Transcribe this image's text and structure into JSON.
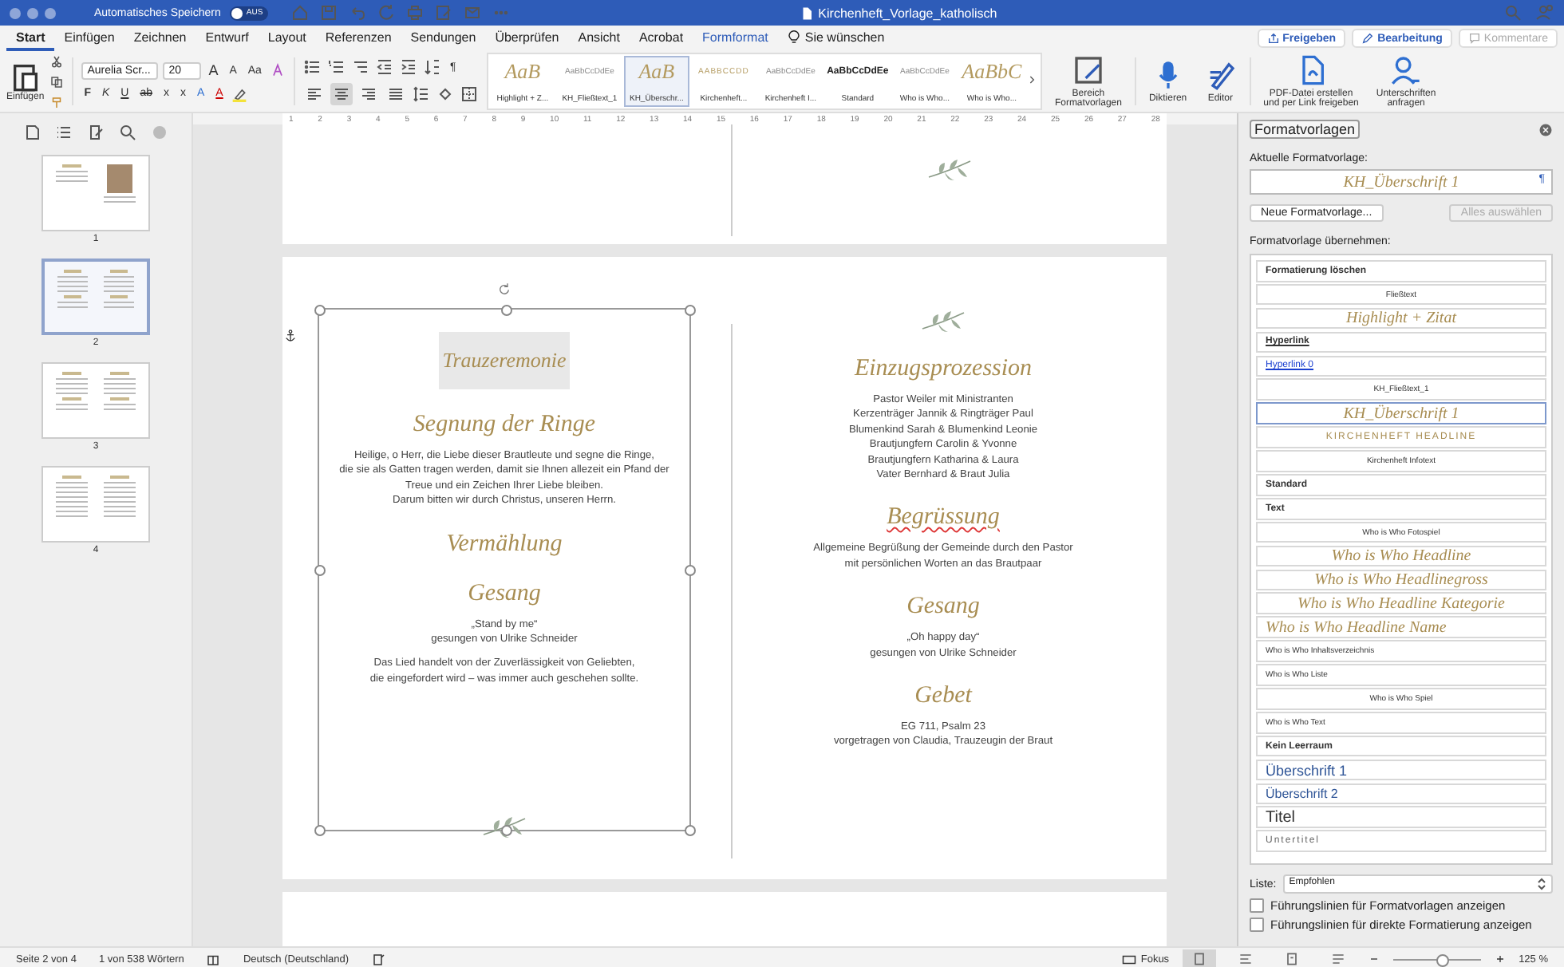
{
  "titlebar": {
    "autosave_label": "Automatisches Speichern",
    "autosave_on": false,
    "toggle_label": "AUS",
    "title": "Kirchenheft_Vorlage_katholisch"
  },
  "tabs": [
    {
      "label": "Start",
      "selected": true,
      "kind": "tab"
    },
    {
      "label": "Einfügen",
      "selected": false,
      "kind": "tab"
    },
    {
      "label": "Zeichnen",
      "selected": false,
      "kind": "tab"
    },
    {
      "label": "Entwurf",
      "selected": false,
      "kind": "tab"
    },
    {
      "label": "Layout",
      "selected": false,
      "kind": "tab"
    },
    {
      "label": "Referenzen",
      "selected": false,
      "kind": "tab"
    },
    {
      "label": "Sendungen",
      "selected": false,
      "kind": "tab"
    },
    {
      "label": "Überprüfen",
      "selected": false,
      "kind": "tab"
    },
    {
      "label": "Ansicht",
      "selected": false,
      "kind": "tab"
    },
    {
      "label": "Acrobat",
      "selected": false,
      "kind": "tab"
    },
    {
      "label": "Formformat",
      "selected": false,
      "kind": "contextual"
    },
    {
      "label": "Sie wünschen",
      "selected": false,
      "kind": "tell"
    }
  ],
  "tab_actions": [
    {
      "label": "Freigeben",
      "kind": "share",
      "disabled": false
    },
    {
      "label": "Bearbeitung",
      "kind": "edit",
      "disabled": false
    },
    {
      "label": "Kommentare",
      "kind": "comment",
      "disabled": true
    }
  ],
  "ribbon": {
    "paste_label": "Einfügen",
    "font_name": "Aurelia Scr...",
    "font_size": "20",
    "font_buttons": [
      {
        "label": "A",
        "kind": "grow"
      },
      {
        "label": "A",
        "kind": "shrink"
      },
      {
        "label": "Aa",
        "kind": "case"
      }
    ],
    "format_buttons": [
      {
        "label": "F",
        "kind": "bold"
      },
      {
        "label": "K",
        "kind": "italic"
      },
      {
        "label": "U",
        "kind": "underline"
      },
      {
        "label": "ab",
        "kind": "strike"
      },
      {
        "label": "x",
        "kind": "sub"
      },
      {
        "label": "x",
        "kind": "sup"
      },
      {
        "label": "A",
        "kind": "effect"
      },
      {
        "label": "A",
        "kind": "color"
      }
    ],
    "alignment": [
      {
        "selected": false
      },
      {
        "selected": true
      },
      {
        "selected": false
      },
      {
        "selected": false
      }
    ],
    "pilcrow": "¶",
    "styles": [
      {
        "preview": "AaB",
        "label": "Highlight + Z...",
        "kind": "script",
        "selected": false
      },
      {
        "preview": "AaBbCcDdEe",
        "label": "KH_Fließtext_1",
        "kind": "small",
        "selected": false
      },
      {
        "preview": "AaB",
        "label": "KH_Überschr...",
        "kind": "script",
        "selected": true
      },
      {
        "preview": "AABBCCDD",
        "label": "Kirchenheft...",
        "kind": "caps",
        "selected": false
      },
      {
        "preview": "AaBbCcDdEe",
        "label": "Kirchenheft I...",
        "kind": "small",
        "selected": false
      },
      {
        "preview": "AaBbCcDdEe",
        "label": "Standard",
        "kind": "bold",
        "selected": false
      },
      {
        "preview": "AaBbCcDdEe",
        "label": "Who is Who...",
        "kind": "small",
        "selected": false
      },
      {
        "preview": "AaBbC",
        "label": "Who is Who...",
        "kind": "script",
        "selected": false
      }
    ],
    "commands": [
      {
        "label": "Bereich\nFormatvorlagen",
        "kind": "pane"
      },
      {
        "label": "Diktieren",
        "kind": "dictate"
      },
      {
        "label": "Editor",
        "kind": "editor"
      },
      {
        "label": "PDF-Datei erstellen\nund per Link freigeben",
        "kind": "pdf"
      },
      {
        "label": "Unterschriften\nanfragen",
        "kind": "sign"
      }
    ]
  },
  "ruler": [
    "1",
    "2",
    "3",
    "4",
    "5",
    "6",
    "7",
    "8",
    "9",
    "10",
    "11",
    "12",
    "13",
    "14",
    "15",
    "16",
    "17",
    "18",
    "19",
    "20",
    "21",
    "22",
    "23",
    "24",
    "25",
    "26",
    "27",
    "28"
  ],
  "thumbnails": [
    {
      "label": "1",
      "selected": false,
      "kind": "cover"
    },
    {
      "label": "2",
      "selected": true,
      "kind": "spread"
    },
    {
      "label": "3",
      "selected": false,
      "kind": "spread"
    },
    {
      "label": "4",
      "selected": false,
      "kind": "list"
    }
  ],
  "document": {
    "columns": [
      {
        "framed": true,
        "blocks": [
          {
            "kind": "boxed-heading",
            "text": "Trauzeremonie",
            "spell_error": false
          },
          {
            "kind": "heading",
            "text": "Segnung der Ringe",
            "spell_error": false
          },
          {
            "kind": "paragraph",
            "lines": [
              "Heilige, o Herr, die Liebe dieser Brautleute und segne die Ringe,",
              "die sie als Gatten tragen werden, damit sie Ihnen allezeit ein Pfand der",
              "Treue und ein Zeichen Ihrer Liebe bleiben.",
              "Darum bitten wir durch Christus, unseren Herrn."
            ]
          },
          {
            "kind": "heading",
            "text": "Vermählung",
            "spell_error": false
          },
          {
            "kind": "heading",
            "text": "Gesang",
            "spell_error": false
          },
          {
            "kind": "paragraph",
            "lines": [
              "„Stand by me“",
              "gesungen von Ulrike Schneider"
            ]
          },
          {
            "kind": "paragraph",
            "lines": [
              "Das Lied handelt von der Zuverlässigkeit von Geliebten,",
              "die eingefordert wird – was immer auch geschehen sollte."
            ]
          },
          {
            "kind": "ornament"
          }
        ]
      },
      {
        "framed": false,
        "blocks": [
          {
            "kind": "ornament"
          },
          {
            "kind": "heading",
            "text": "Einzugsprozession",
            "spell_error": false
          },
          {
            "kind": "paragraph",
            "lines": [
              "Pastor Weiler mit Ministranten",
              "Kerzenträger Jannik & Ringträger Paul",
              "Blumenkind Sarah & Blumenkind Leonie",
              "Brautjungfern Carolin & Yvonne",
              "Brautjungfern Katharina & Laura",
              "Vater Bernhard & Braut Julia"
            ]
          },
          {
            "kind": "heading",
            "text": "Begrüssung",
            "spell_error": true
          },
          {
            "kind": "paragraph",
            "lines": [
              "Allgemeine Begrüßung der Gemeinde durch den Pastor",
              "mit persönlichen Worten an das Brautpaar"
            ]
          },
          {
            "kind": "heading",
            "text": "Gesang",
            "spell_error": false
          },
          {
            "kind": "paragraph",
            "lines": [
              "„Oh happy day“",
              "gesungen von Ulrike Schneider"
            ]
          },
          {
            "kind": "heading",
            "text": "Gebet",
            "spell_error": false
          },
          {
            "kind": "paragraph",
            "lines": [
              "EG 711, Psalm 23",
              "vorgetragen von Claudia, Trauzeugin der Braut"
            ]
          }
        ]
      }
    ]
  },
  "styles_pane": {
    "title": "Formatvorlagen",
    "current_label": "Aktuelle Formatvorlage:",
    "current_value": "KH_Überschrift 1",
    "new_button": "Neue Formatvorlage...",
    "select_all": {
      "label": "Alles auswählen",
      "disabled": true
    },
    "apply_label": "Formatvorlage übernehmen:",
    "styles": [
      {
        "label": "Formatierung löschen",
        "kind": "bold",
        "selected": false
      },
      {
        "label": "Fließtext",
        "kind": "small-center",
        "selected": false
      },
      {
        "label": "Highlight + Zitat",
        "kind": "script",
        "selected": false
      },
      {
        "label": "Hyperlink",
        "kind": "underline",
        "selected": false
      },
      {
        "label": "Hyperlink 0",
        "kind": "link",
        "selected": false
      },
      {
        "label": "KH_Fließtext_1",
        "kind": "small-center",
        "selected": false
      },
      {
        "label": "KH_Überschrift 1",
        "kind": "script",
        "selected": true
      },
      {
        "label": "KIRCHENHEFT HEADLINE",
        "kind": "caps",
        "selected": false
      },
      {
        "label": "Kirchenheft Infotext",
        "kind": "small-center",
        "selected": false
      },
      {
        "label": "Standard",
        "kind": "bold",
        "selected": false
      },
      {
        "label": "Text",
        "kind": "bold",
        "selected": false
      },
      {
        "label": "Who is Who Fotospiel",
        "kind": "small-center",
        "selected": false
      },
      {
        "label": "Who is Who Headline",
        "kind": "script",
        "selected": false
      },
      {
        "label": "Who is Who Headlinegross",
        "kind": "script",
        "selected": false
      },
      {
        "label": "Who is Who Headline Kategorie",
        "kind": "script",
        "selected": false
      },
      {
        "label": "Who is Who Headline Name",
        "kind": "script-left",
        "selected": false
      },
      {
        "label": "Who is Who Inhaltsverzeichnis",
        "kind": "small-left",
        "selected": false
      },
      {
        "label": "Who is Who Liste",
        "kind": "small-left",
        "selected": false
      },
      {
        "label": "Who is Who Spiel",
        "kind": "small-center",
        "selected": false
      },
      {
        "label": "Who is Who Text",
        "kind": "small-left",
        "selected": false
      },
      {
        "label": "Kein Leerraum",
        "kind": "bold",
        "selected": false
      },
      {
        "label": "Überschrift 1",
        "kind": "heading1",
        "selected": false
      },
      {
        "label": "Überschrift 2",
        "kind": "heading2",
        "selected": false
      },
      {
        "label": "Titel",
        "kind": "title",
        "selected": false
      },
      {
        "label": "Untertitel",
        "kind": "subtitle",
        "selected": false
      }
    ],
    "list_label": "Liste:",
    "list_value": "Empfohlen",
    "options": [
      {
        "label": "Führungslinien für Formatvorlagen anzeigen",
        "checked": false
      },
      {
        "label": "Führungslinien für direkte Formatierung anzeigen",
        "checked": false
      }
    ]
  },
  "status_bar": {
    "page": "Seite 2 von 4",
    "words": "1 von 538 Wörtern",
    "language": "Deutsch (Deutschland)",
    "focus": "Fokus",
    "views": [
      {
        "selected": true
      },
      {
        "selected": false
      },
      {
        "selected": false
      },
      {
        "selected": false
      }
    ],
    "zoom": {
      "level": 0.55,
      "reading": "125 %"
    }
  }
}
